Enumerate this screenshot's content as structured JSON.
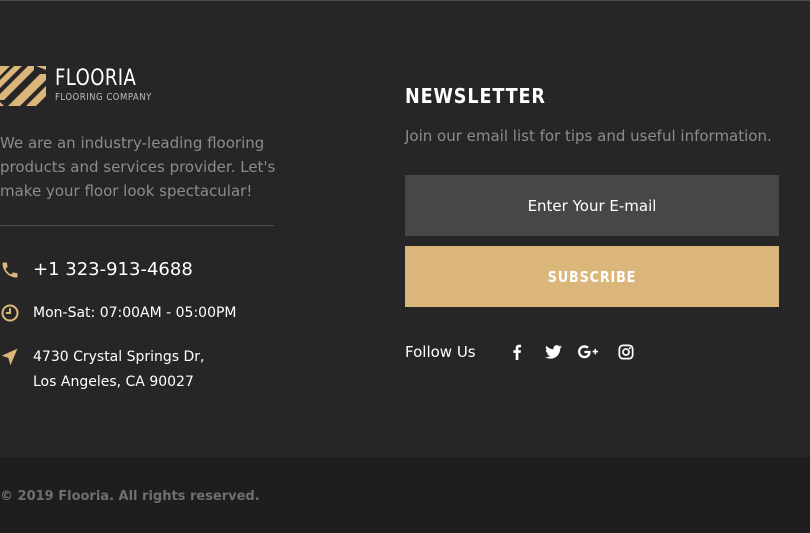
{
  "brand": {
    "name": "FLOORIA",
    "tagline": "FLOORING COMPANY"
  },
  "about": {
    "text": "We are an industry-leading flooring products and services provider. Let's make your floor look spectacular!"
  },
  "contact": {
    "phone": "+1 323-913-4688",
    "hours": "Mon-Sat: 07:00AM - 05:00PM",
    "address_line1": "4730 Crystal Springs Dr,",
    "address_line2": "Los Angeles, CA 90027"
  },
  "newsletter": {
    "title": "NEWSLETTER",
    "description": "Join our email list for tips and useful information.",
    "email_placeholder": "Enter Your E-mail",
    "subscribe_label": "SUBSCRIBE"
  },
  "social": {
    "follow_label": "Follow Us",
    "icons": [
      "facebook-icon",
      "twitter-icon",
      "google-plus-icon",
      "instagram-icon"
    ]
  },
  "footer": {
    "copyright": "© 2019 Flooria. All rights reserved."
  },
  "colors": {
    "background": "#262626",
    "bottom_bar": "#1e1e1e",
    "accent": "#dbb67b",
    "input_bg": "#474747",
    "muted_text": "#8c8c8c"
  }
}
